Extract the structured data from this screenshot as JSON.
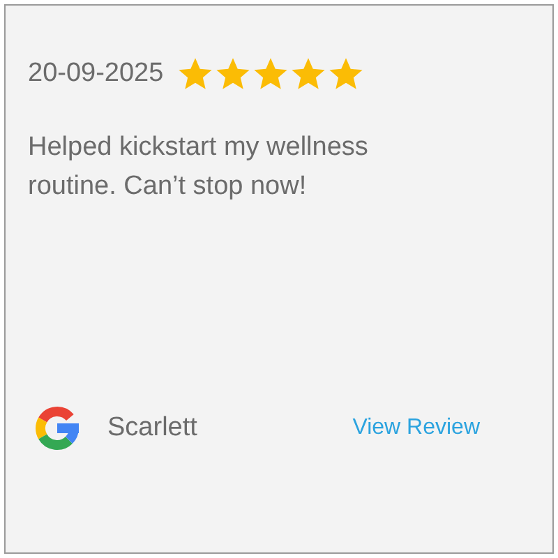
{
  "review": {
    "date": "20-09-2025",
    "stars": 5,
    "text": "Helped kickstart my wellness routine. Can’t stop now!",
    "author": "Scarlett",
    "link": "View Review"
  }
}
